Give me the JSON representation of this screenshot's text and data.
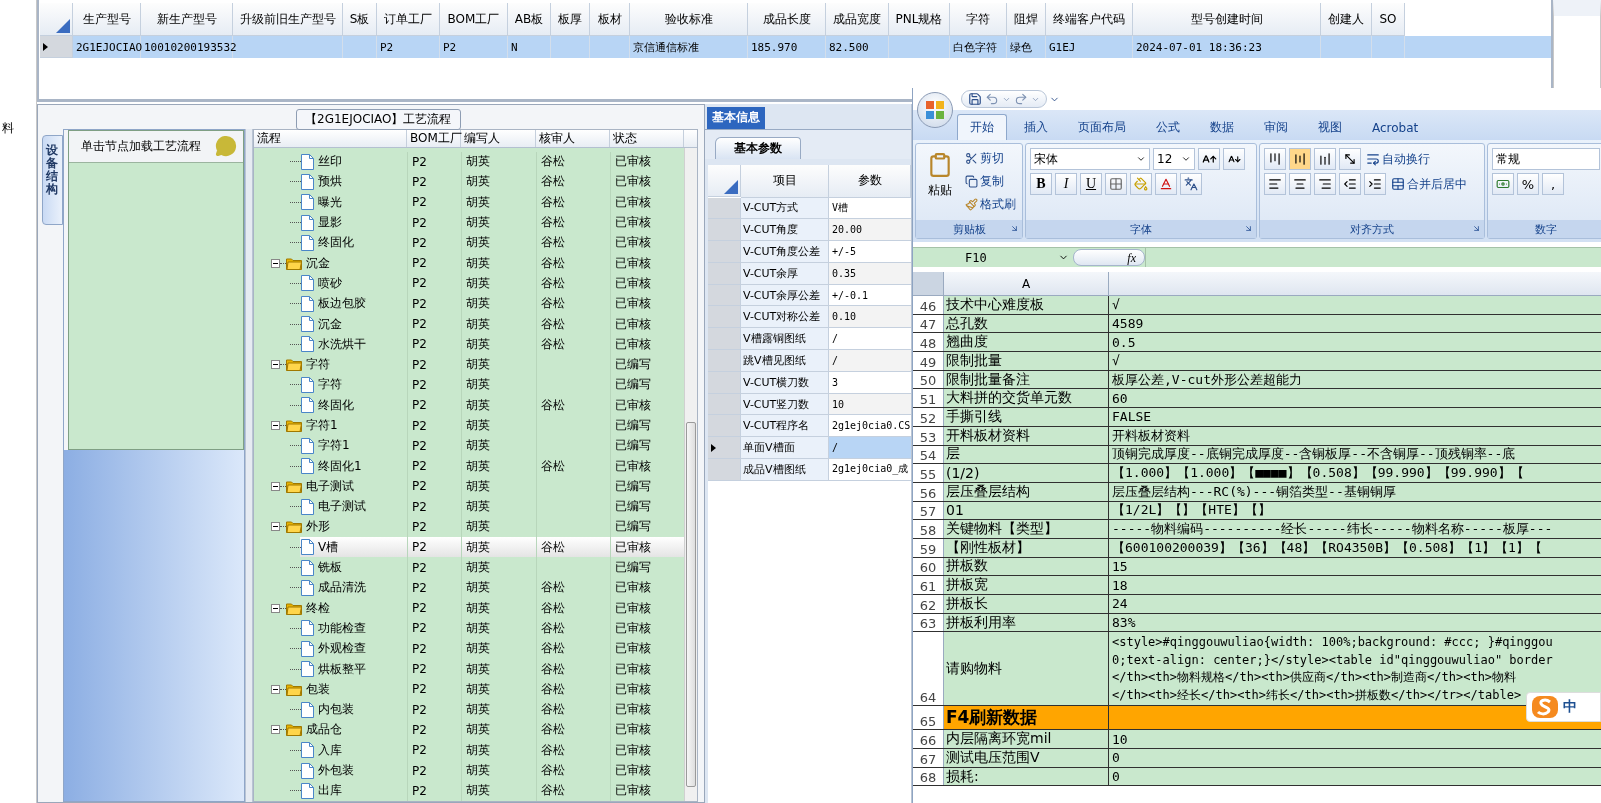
{
  "left_edge_text": "料",
  "order_grid": {
    "row": {
      "selected": true
    },
    "columns": [
      {
        "label": "生产型号",
        "value": "2G1EJOCIAO"
      },
      {
        "label": "新生产型号",
        "value": "10010200193532"
      },
      {
        "label": "升级前旧生产型号"
      },
      {
        "label": "S板"
      },
      {
        "label": "订单工厂",
        "value": "P2"
      },
      {
        "label": "BOM工厂",
        "value": "P2"
      },
      {
        "label": "AB板",
        "value": "N"
      },
      {
        "label": "板厚"
      },
      {
        "label": "板材"
      },
      {
        "label": "验收标准",
        "value": "京信通信标准"
      },
      {
        "label": "成品长度",
        "value": "185.970"
      },
      {
        "label": "成品宽度",
        "value": "82.500"
      },
      {
        "label": "PNL规格"
      },
      {
        "label": "字符",
        "value": "白色字符"
      },
      {
        "label": "阻焊",
        "value": "绿色"
      },
      {
        "label": "终端客户代码",
        "value": "G1EJ"
      },
      {
        "label": "型号创建时间",
        "value": "2024-07-01 18:36:23"
      },
      {
        "label": "创建人"
      },
      {
        "label": "SO"
      }
    ]
  },
  "process": {
    "title": "【2G1EJOCIAO】工艺流程",
    "side_tab": "设备结构",
    "hint": "单击节点加载工艺流程",
    "columns": [
      "流程",
      "BOM工厂",
      "编写人",
      "核审人",
      "状态"
    ],
    "continued_children": [
      {
        "name": "丝印",
        "bom": "P2",
        "writer": "胡英",
        "reviewer": "谷松",
        "status": "已审核",
        "selected": false
      },
      {
        "name": "预烘",
        "bom": "P2",
        "writer": "胡英",
        "reviewer": "谷松",
        "status": "已审核",
        "selected": false
      },
      {
        "name": "曝光",
        "bom": "P2",
        "writer": "胡英",
        "reviewer": "谷松",
        "status": "已审核",
        "selected": false
      },
      {
        "name": "显影",
        "bom": "P2",
        "writer": "胡英",
        "reviewer": "谷松",
        "status": "已审核",
        "selected": false
      },
      {
        "name": "终固化",
        "bom": "P2",
        "writer": "胡英",
        "reviewer": "谷松",
        "status": "已审核",
        "selected": false
      }
    ],
    "nodes": [
      {
        "name": "沉金",
        "bom": "P2",
        "writer": "胡英",
        "reviewer": "谷松",
        "status": "已审核",
        "selected": false,
        "expanded": true,
        "children": [
          {
            "name": "喷砂",
            "bom": "P2",
            "writer": "胡英",
            "reviewer": "谷松",
            "status": "已审核",
            "selected": false
          },
          {
            "name": "板边包胶",
            "bom": "P2",
            "writer": "胡英",
            "reviewer": "谷松",
            "status": "已审核",
            "selected": false
          },
          {
            "name": "沉金",
            "bom": "P2",
            "writer": "胡英",
            "reviewer": "谷松",
            "status": "已审核",
            "selected": false
          },
          {
            "name": "水洗烘干",
            "bom": "P2",
            "writer": "胡英",
            "reviewer": "谷松",
            "status": "已审核",
            "selected": false
          }
        ]
      },
      {
        "name": "字符",
        "bom": "P2",
        "writer": "胡英",
        "status": "已编写",
        "selected": false,
        "expanded": true,
        "children": [
          {
            "name": "字符",
            "bom": "P2",
            "writer": "胡英",
            "status": "已编写",
            "selected": false
          },
          {
            "name": "终固化",
            "bom": "P2",
            "writer": "胡英",
            "reviewer": "谷松",
            "status": "已审核",
            "selected": false
          }
        ]
      },
      {
        "name": "字符1",
        "bom": "P2",
        "writer": "胡英",
        "status": "已编写",
        "selected": false,
        "expanded": true,
        "children": [
          {
            "name": "字符1",
            "bom": "P2",
            "writer": "胡英",
            "status": "已编写",
            "selected": false
          },
          {
            "name": "终固化1",
            "bom": "P2",
            "writer": "胡英",
            "reviewer": "谷松",
            "status": "已审核",
            "selected": false
          }
        ]
      },
      {
        "name": "电子测试",
        "bom": "P2",
        "writer": "胡英",
        "status": "已编写",
        "selected": false,
        "expanded": true,
        "children": [
          {
            "name": "电子测试",
            "bom": "P2",
            "writer": "胡英",
            "status": "已编写",
            "selected": false
          }
        ]
      },
      {
        "name": "外形",
        "bom": "P2",
        "writer": "胡英",
        "status": "已编写",
        "selected": false,
        "expanded": true,
        "children": [
          {
            "name": "V槽",
            "bom": "P2",
            "writer": "胡英",
            "reviewer": "谷松",
            "status": "已审核",
            "selected": true
          },
          {
            "name": "铣板",
            "bom": "P2",
            "writer": "胡英",
            "status": "已编写",
            "selected": false
          },
          {
            "name": "成品清洗",
            "bom": "P2",
            "writer": "胡英",
            "reviewer": "谷松",
            "status": "已审核",
            "selected": false
          }
        ]
      },
      {
        "name": "终检",
        "bom": "P2",
        "writer": "胡英",
        "reviewer": "谷松",
        "status": "已审核",
        "selected": false,
        "expanded": true,
        "children": [
          {
            "name": "功能检查",
            "bom": "P2",
            "writer": "胡英",
            "reviewer": "谷松",
            "status": "已审核",
            "selected": false
          },
          {
            "name": "外观检查",
            "bom": "P2",
            "writer": "胡英",
            "reviewer": "谷松",
            "status": "已审核",
            "selected": false
          },
          {
            "name": "烘板整平",
            "bom": "P2",
            "writer": "胡英",
            "reviewer": "谷松",
            "status": "已审核",
            "selected": false
          }
        ]
      },
      {
        "name": "包装",
        "bom": "P2",
        "writer": "胡英",
        "reviewer": "谷松",
        "status": "已审核",
        "selected": false,
        "expanded": true,
        "children": [
          {
            "name": "内包装",
            "bom": "P2",
            "writer": "胡英",
            "reviewer": "谷松",
            "status": "已审核",
            "selected": false
          }
        ]
      },
      {
        "name": "成品仓",
        "bom": "P2",
        "writer": "胡英",
        "reviewer": "谷松",
        "status": "已审核",
        "selected": false,
        "expanded": true,
        "children": [
          {
            "name": "入库",
            "bom": "P2",
            "writer": "胡英",
            "reviewer": "谷松",
            "status": "已审核",
            "selected": false
          },
          {
            "name": "外包装",
            "bom": "P2",
            "writer": "胡英",
            "reviewer": "谷松",
            "status": "已审核",
            "selected": false
          },
          {
            "name": "出库",
            "bom": "P2",
            "writer": "胡英",
            "reviewer": "谷松",
            "status": "已审核",
            "selected": false
          }
        ]
      }
    ]
  },
  "params": {
    "tab": "基本信息",
    "sub_tab": "基本参数",
    "columns": [
      "项目",
      "参数"
    ],
    "rows": [
      {
        "item": "V-CUT方式",
        "value": "V槽",
        "selected": false
      },
      {
        "item": "V-CUT角度",
        "value": "20.00",
        "selected": false
      },
      {
        "item": "V-CUT角度公差",
        "value": "+/-5",
        "selected": false
      },
      {
        "item": "V-CUT余厚",
        "value": "0.35",
        "selected": false
      },
      {
        "item": "V-CUT余厚公差",
        "value": "+/-0.1",
        "selected": false
      },
      {
        "item": "V-CUT对称公差",
        "value": "0.10",
        "selected": false
      },
      {
        "item": "V槽露铜图纸",
        "value": "/",
        "selected": false
      },
      {
        "item": "跳V槽见图纸",
        "value": "/",
        "selected": false
      },
      {
        "item": "V-CUT横刀数",
        "value": "3",
        "selected": false
      },
      {
        "item": "V-CUT竖刀数",
        "value": "10",
        "selected": false
      },
      {
        "item": "V-CUT程序名",
        "value": "2g1ej0cia0.CS",
        "selected": false
      },
      {
        "item": "单面V槽面",
        "value": "/",
        "selected": true
      },
      {
        "item": "成品V槽图纸",
        "value": "2g1ej0cia0_成",
        "selected": false
      }
    ]
  },
  "excel": {
    "tabs": [
      {
        "label": "开始",
        "selected": true
      },
      {
        "label": "插入",
        "selected": false
      },
      {
        "label": "页面布局",
        "selected": false
      },
      {
        "label": "公式",
        "selected": false
      },
      {
        "label": "数据",
        "selected": false
      },
      {
        "label": "审阅",
        "selected": false
      },
      {
        "label": "视图",
        "selected": false
      },
      {
        "label": "Acrobat",
        "selected": false
      }
    ],
    "clipboard": {
      "paste": "粘贴",
      "cut": "剪切",
      "copy": "复制",
      "format_painter": "格式刷",
      "label": "剪贴板"
    },
    "font": {
      "name": "宋体",
      "size": "12",
      "styles": [
        {
          "kind": "bold",
          "label": "B"
        },
        {
          "kind": "italic",
          "label": "I"
        },
        {
          "kind": "underline",
          "label": "U"
        }
      ],
      "label": "字体"
    },
    "alignment": {
      "vertical": [
        {
          "selected": false
        },
        {
          "selected": true
        },
        {
          "selected": false
        }
      ],
      "wrap": "自动换行",
      "merge": "合并后居中",
      "label": "对齐方式"
    },
    "number": {
      "format": "常规",
      "percent": "%",
      "comma": ",",
      "label": "数字"
    },
    "name_box": "F10",
    "fx": "fx",
    "column_header": "A",
    "rows": [
      {
        "kind": "normal",
        "num": "46",
        "a": "技术中心难度板",
        "b": "√"
      },
      {
        "kind": "normal",
        "num": "47",
        "a": "总孔数",
        "b": "4589"
      },
      {
        "kind": "normal",
        "num": "48",
        "a": "翘曲度",
        "b": "0.5"
      },
      {
        "kind": "normal",
        "num": "49",
        "a": "限制批量",
        "b": "√"
      },
      {
        "kind": "normal",
        "num": "50",
        "a": "限制批量备注",
        "b": "板厚公差,V-cut外形公差超能力"
      },
      {
        "kind": "normal",
        "num": "51",
        "a": "大料拼的交货单元数",
        "b": "60"
      },
      {
        "kind": "normal",
        "num": "52",
        "a": "手撕引线",
        "b": "FALSE"
      },
      {
        "kind": "normal",
        "num": "53",
        "a": "开料板材资料",
        "b": "开料板材资料"
      },
      {
        "kind": "normal",
        "num": "54",
        "a": "层",
        "b": "顶铜完成厚度--底铜完成厚度--含铜板厚--不含铜厚--顶残铜率--底"
      },
      {
        "kind": "normal",
        "num": "55",
        "a": "(1/2)",
        "b": "【1.000】【1.000】【■■■■】【0.508】【99.990】【99.990】【"
      },
      {
        "kind": "normal",
        "num": "56",
        "a": "层压叠层结构",
        "b": "层压叠层结构---RC(%)---铜箔类型--基铜铜厚"
      },
      {
        "kind": "normal",
        "num": "57",
        "a": "01",
        "b": "【1/2L】【】【HTE】【】"
      },
      {
        "kind": "normal",
        "num": "58",
        "a": "关键物料【类型】",
        "b": "-----物料编码----------经长-----纬长-----物料名称-----板厚---"
      },
      {
        "kind": "normal",
        "num": "59",
        "a": "【刚性板材】",
        "b": "【600100200039】【36】【48】【RO4350B】【0.508】【1】【1】【"
      },
      {
        "kind": "normal",
        "num": "60",
        "a": "拼板数",
        "b": "15"
      },
      {
        "kind": "normal",
        "num": "61",
        "a": "拼板宽",
        "b": "18"
      },
      {
        "kind": "normal",
        "num": "62",
        "a": "拼板长",
        "b": "24"
      },
      {
        "kind": "normal",
        "num": "63",
        "a": "拼板利用率",
        "b": "83%"
      },
      {
        "kind": "multiline",
        "num": "64",
        "a": "请购物料",
        "lines": [
          "<style>#qinggouwuliao{width: 100%;background: #ccc; }#qinggou",
          "0;text-align: center;}</style><table id\"qinggouwuliao\" border",
          "</th><th>物料规格</th><th>供应商</th><th>制造商</th><th>物料",
          "</th><th>经长</th><th>纬长</th><th>拼板数</th></tr></table>"
        ]
      },
      {
        "kind": "heading",
        "num": "65",
        "a": "F4刷新数据"
      },
      {
        "kind": "normal",
        "num": "66",
        "a": "内层隔离环宽mil",
        "b": "10"
      },
      {
        "kind": "normal",
        "num": "67",
        "a": "测试电压范围V",
        "b": "0"
      },
      {
        "kind": "normal",
        "num": "68",
        "a": "损耗:",
        "b": "0"
      }
    ],
    "ime": "中"
  }
}
